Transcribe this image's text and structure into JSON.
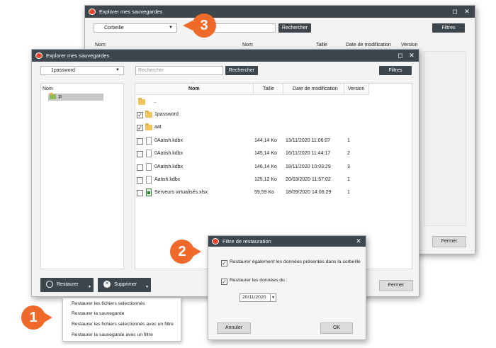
{
  "back_window": {
    "title": "Explorer mes sauvegardes",
    "select_value": "Corbeille",
    "search_label": "Rechercher",
    "filters_label": "Filtres",
    "columns": [
      "Nom",
      "Nom",
      "Taille",
      "Date de modification",
      "Version"
    ],
    "close_label": "Fermer"
  },
  "main_window": {
    "title": "Explorer mes sauvegardes",
    "select_value": "1password",
    "search_placeholder": "Rechercher",
    "search_label": "Rechercher",
    "filters_label": "Filtres",
    "tree_header": "Nom",
    "tree_item": "p",
    "columns": {
      "name": "Nom",
      "size": "Taille",
      "date": "Date de modification",
      "version": "Version"
    },
    "rows": [
      {
        "type": "up",
        "name": "..",
        "size": "",
        "date": "",
        "version": "",
        "checked": false
      },
      {
        "type": "folder",
        "name": "1password",
        "size": "",
        "date": "",
        "version": "",
        "checked": true
      },
      {
        "type": "folder",
        "name": "aat",
        "size": "",
        "date": "",
        "version": "",
        "checked": true
      },
      {
        "type": "file",
        "name": "0Aatish.kdbx",
        "size": "144,14 Ko",
        "date": "13/11/2020 11:06:07",
        "version": "1",
        "checked": false
      },
      {
        "type": "file",
        "name": "0Aatish.kdbx",
        "size": "145,14 Ko",
        "date": "16/11/2020 11:44:17",
        "version": "2",
        "checked": false
      },
      {
        "type": "file",
        "name": "0Aatish.kdbx",
        "size": "146,14 Ko",
        "date": "18/11/2020 10:03:29",
        "version": "3",
        "checked": false
      },
      {
        "type": "file",
        "name": "Aatish.kdbx",
        "size": "125,12 Ko",
        "date": "20/03/2020 11:57:02",
        "version": "1",
        "checked": false
      },
      {
        "type": "xlsx",
        "name": "Serveurs virtualisés.xlsx",
        "size": "59,59 Ko",
        "date": "18/09/2020 14:06:29",
        "version": "1",
        "checked": false
      }
    ],
    "restore_label": "Restaurer",
    "delete_label": "Supprimer",
    "close_label": "Fermer"
  },
  "restore_menu": {
    "items": [
      "Restaurer les fichiers selectionnés",
      "Restaurer la sauvegarde",
      "Restaurer les fichiers selectionnés avec un filtre",
      "Restaurer la sauvegarde avec un filtre"
    ]
  },
  "dialog": {
    "title": "Filtre de restauration",
    "option_trash": "Restaurer également les données présentes dans la corbeille",
    "option_date": "Restaurer les données du :",
    "date_value": "20/11/2020",
    "cancel_label": "Annuler",
    "ok_label": "OK"
  },
  "callouts": [
    "1",
    "2",
    "3"
  ],
  "colors": {
    "titlebar": "#3d464d",
    "accent": "#ef6a2a",
    "window_bg": "#f3f3f3"
  }
}
